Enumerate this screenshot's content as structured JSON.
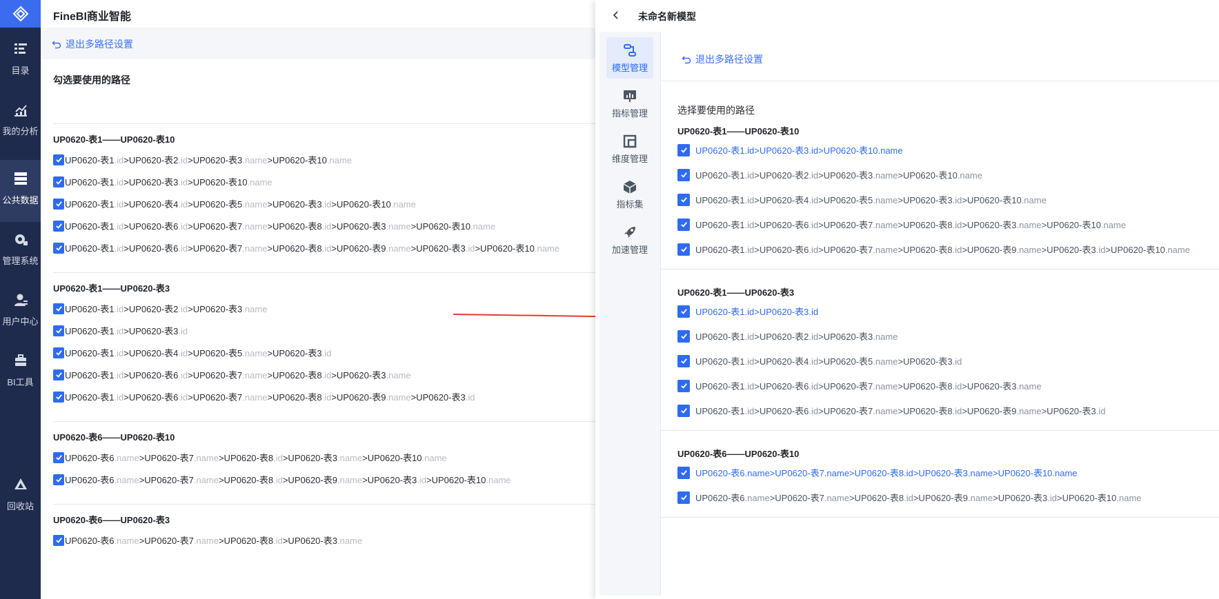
{
  "nav": {
    "items": [
      {
        "label": "目录",
        "icon": "list-icon"
      },
      {
        "label": "我的分析",
        "icon": "chart-icon"
      },
      {
        "label": "公共数据",
        "icon": "database-icon"
      },
      {
        "label": "管理系统",
        "icon": "gear-icon"
      },
      {
        "label": "用户中心",
        "icon": "user-icon"
      },
      {
        "label": "BI工具",
        "icon": "toolbox-icon"
      },
      {
        "label": "回收站",
        "icon": "recycle-icon"
      }
    ],
    "active": "公共数据"
  },
  "left": {
    "app_title": "FineBI商业智能",
    "exit_label": "退出多路径设置",
    "heading": "勾选要使用的路径",
    "groups": [
      {
        "title": "UP0620-表1——UP0620-表10",
        "paths": [
          "UP0620-表1.id>UP0620-表2.id>UP0620-表3.name>UP0620-表10.name",
          "UP0620-表1.id>UP0620-表3.id>UP0620-表10.name",
          "UP0620-表1.id>UP0620-表4.id>UP0620-表5.name>UP0620-表3.id>UP0620-表10.name",
          "UP0620-表1.id>UP0620-表6.id>UP0620-表7.name>UP0620-表8.id>UP0620-表3.name>UP0620-表10.name",
          "UP0620-表1.id>UP0620-表6.id>UP0620-表7.name>UP0620-表8.id>UP0620-表9.name>UP0620-表3.id>UP0620-表10.name"
        ]
      },
      {
        "title": "UP0620-表1——UP0620-表3",
        "paths": [
          "UP0620-表1.id>UP0620-表2.id>UP0620-表3.name",
          "UP0620-表1.id>UP0620-表3.id",
          "UP0620-表1.id>UP0620-表4.id>UP0620-表5.name>UP0620-表3.id",
          "UP0620-表1.id>UP0620-表6.id>UP0620-表7.name>UP0620-表8.id>UP0620-表3.name",
          "UP0620-表1.id>UP0620-表6.id>UP0620-表7.name>UP0620-表8.id>UP0620-表9.name>UP0620-表3.id"
        ]
      },
      {
        "title": "UP0620-表6——UP0620-表10",
        "paths": [
          "UP0620-表6.name>UP0620-表7.name>UP0620-表8.id>UP0620-表3.name>UP0620-表10.name",
          "UP0620-表6.name>UP0620-表7.name>UP0620-表8.id>UP0620-表9.name>UP0620-表3.id>UP0620-表10.name"
        ]
      },
      {
        "title": "UP0620-表6——UP0620-表3",
        "paths": [
          "UP0620-表6.name>UP0620-表7.name>UP0620-表8.id>UP0620-表3.name"
        ]
      }
    ]
  },
  "right": {
    "model_title": "未命名新模型",
    "exit_label": "退出多路径设置",
    "heading": "选择要使用的路径",
    "sidebar": [
      {
        "label": "模型管理",
        "icon": "model-icon",
        "active": true
      },
      {
        "label": "指标管理",
        "icon": "metric-icon",
        "active": false
      },
      {
        "label": "维度管理",
        "icon": "dimension-icon",
        "active": false
      },
      {
        "label": "指标集",
        "icon": "cube-icon",
        "active": false
      },
      {
        "label": "加速管理",
        "icon": "rocket-icon",
        "active": false
      }
    ],
    "groups": [
      {
        "title": "UP0620-表1——UP0620-表10",
        "paths": [
          {
            "text": "UP0620-表1.id>UP0620-表3.id>UP0620-表10.name",
            "selected": true
          },
          {
            "text": "UP0620-表1.id>UP0620-表2.id>UP0620-表3.name>UP0620-表10.name",
            "selected": false
          },
          {
            "text": "UP0620-表1.id>UP0620-表4.id>UP0620-表5.name>UP0620-表3.id>UP0620-表10.name",
            "selected": false
          },
          {
            "text": "UP0620-表1.id>UP0620-表6.id>UP0620-表7.name>UP0620-表8.id>UP0620-表3.name>UP0620-表10.name",
            "selected": false
          },
          {
            "text": "UP0620-表1.id>UP0620-表6.id>UP0620-表7.name>UP0620-表8.id>UP0620-表9.name>UP0620-表3.id>UP0620-表10.name",
            "selected": false
          }
        ]
      },
      {
        "title": "UP0620-表1——UP0620-表3",
        "paths": [
          {
            "text": "UP0620-表1.id>UP0620-表3.id",
            "selected": true
          },
          {
            "text": "UP0620-表1.id>UP0620-表2.id>UP0620-表3.name",
            "selected": false
          },
          {
            "text": "UP0620-表1.id>UP0620-表4.id>UP0620-表5.name>UP0620-表3.id",
            "selected": false
          },
          {
            "text": "UP0620-表1.id>UP0620-表6.id>UP0620-表7.name>UP0620-表8.id>UP0620-表3.name",
            "selected": false
          },
          {
            "text": "UP0620-表1.id>UP0620-表6.id>UP0620-表7.name>UP0620-表8.id>UP0620-表9.name>UP0620-表3.id",
            "selected": false
          }
        ]
      },
      {
        "title": "UP0620-表6——UP0620-表10",
        "paths": [
          {
            "text": "UP0620-表6.name>UP0620-表7.name>UP0620-表8.id>UP0620-表3.name>UP0620-表10.name",
            "selected": true
          },
          {
            "text": "UP0620-表6.name>UP0620-表7.name>UP0620-表8.id>UP0620-表9.name>UP0620-表3.id>UP0620-表10.name",
            "selected": false
          }
        ]
      }
    ]
  },
  "colors": {
    "accent": "#2f6bf0",
    "nav_bg": "#1f2b4d",
    "logo_bg": "#3b6cf0",
    "arrow": "#e53935",
    "muted_field": "#b5bac2"
  }
}
